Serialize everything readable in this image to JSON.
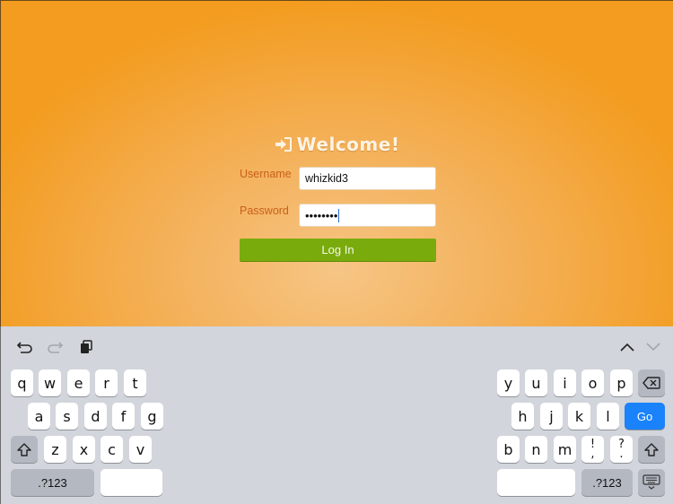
{
  "app": {
    "title": "Welcome!",
    "title_icon": "sign-in-icon",
    "username_label": "Username",
    "username_value": "whizkid3",
    "password_label": "Password",
    "password_value": "••••••••",
    "login_button": "Log In",
    "colors": {
      "background": "#f39c1f",
      "label": "#c8601a",
      "button": "#7aab0c"
    }
  },
  "keyboard": {
    "toolbar": {
      "undo_icon": "undo-icon",
      "redo_icon": "redo-icon",
      "paste_icon": "paste-icon",
      "prev_icon": "chevron-up-icon",
      "next_icon": "chevron-down-icon"
    },
    "row1_left": [
      "q",
      "w",
      "e",
      "r",
      "t"
    ],
    "row1_right": [
      "y",
      "u",
      "i",
      "o",
      "p"
    ],
    "row2_left": [
      "a",
      "s",
      "d",
      "f",
      "g"
    ],
    "row2_right": [
      "h",
      "j",
      "k",
      "l"
    ],
    "row3_left": [
      "z",
      "x",
      "c",
      "v"
    ],
    "row3_right": [
      "b",
      "n",
      "m"
    ],
    "punct1_top": "!",
    "punct1_bottom": ",",
    "punct2_top": "?",
    "punct2_bottom": ".",
    "go_label": "Go",
    "numbers_label": ".?123",
    "go_color": "#1a82fb"
  }
}
